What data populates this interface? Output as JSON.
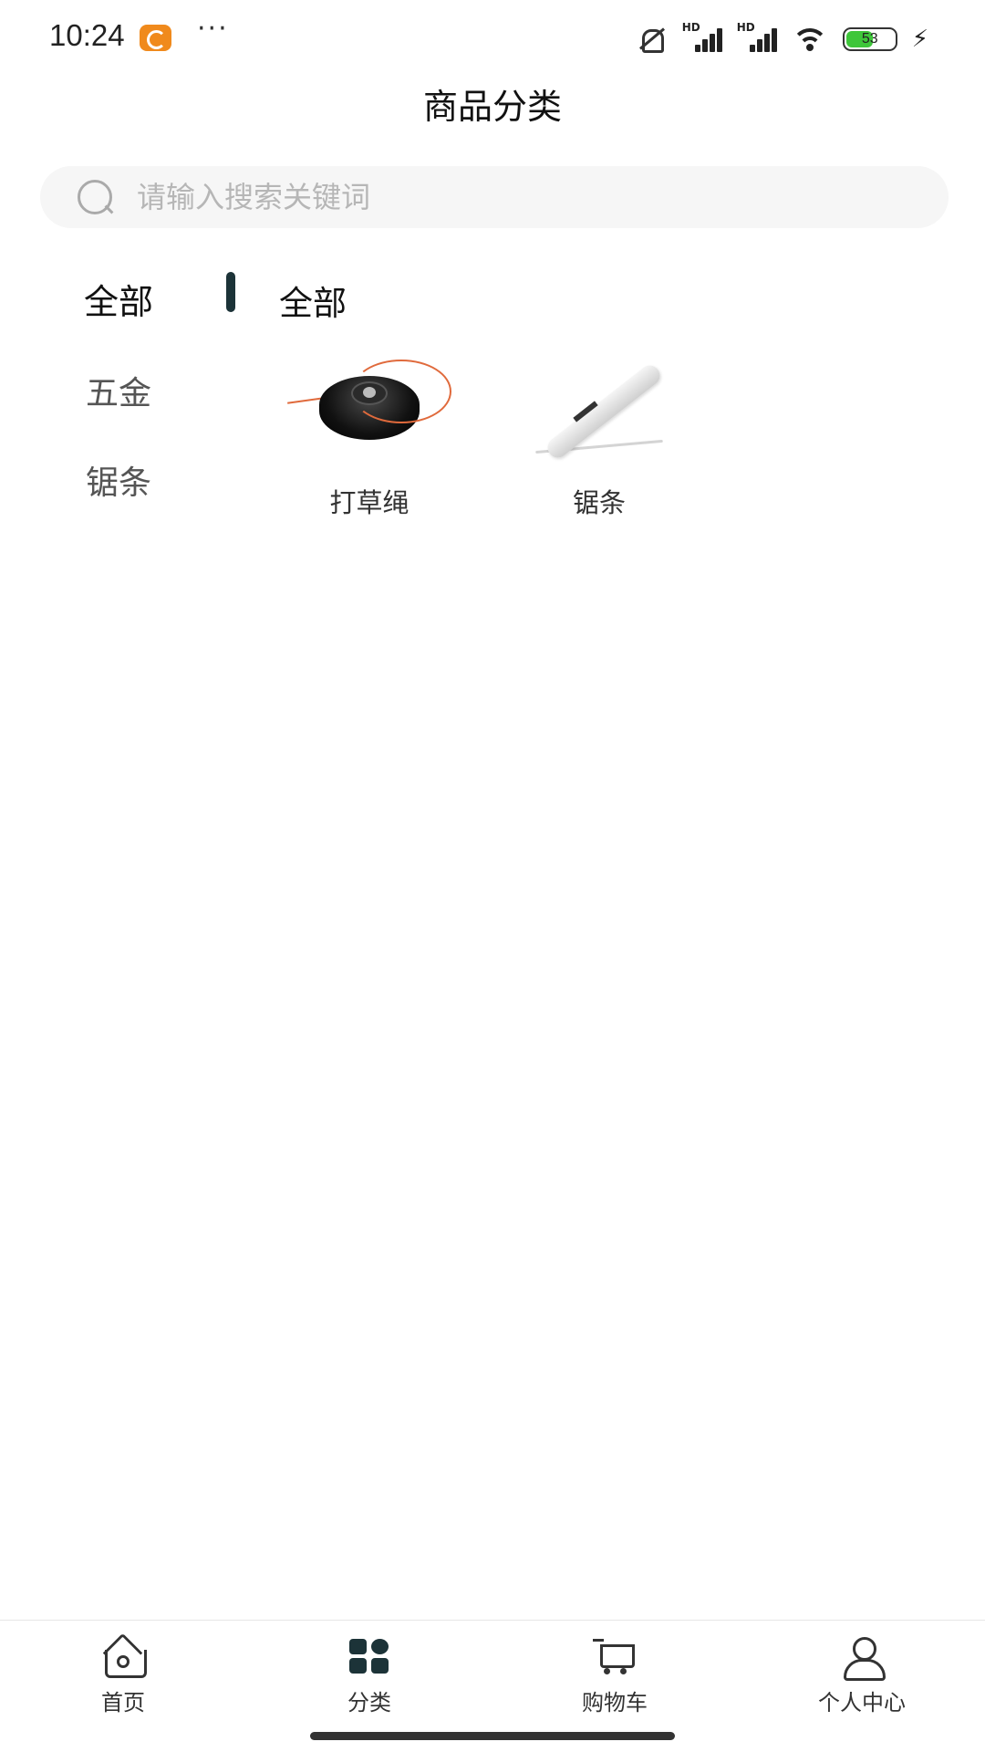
{
  "status_bar": {
    "time": "10:24",
    "more": "···",
    "hd_label": "HD",
    "battery_level": "53",
    "charge_glyph": "⚡"
  },
  "header": {
    "title": "商品分类"
  },
  "search": {
    "placeholder": "请输入搜索关键词",
    "value": ""
  },
  "sidebar": {
    "items": [
      {
        "label": "全部",
        "active": true
      },
      {
        "label": "五金",
        "active": false
      },
      {
        "label": "锯条",
        "active": false
      }
    ]
  },
  "content": {
    "section_title": "全部",
    "products": [
      {
        "name": "打草绳",
        "image": "trimmer-head-image"
      },
      {
        "name": "锯条",
        "image": "saw-bar-image"
      }
    ]
  },
  "tab_bar": {
    "tabs": [
      {
        "label": "首页",
        "icon": "home-icon"
      },
      {
        "label": "分类",
        "icon": "category-grid-icon",
        "active": true
      },
      {
        "label": "购物车",
        "icon": "cart-icon"
      },
      {
        "label": "个人中心",
        "icon": "user-icon"
      }
    ]
  },
  "colors": {
    "accent": "#1c3338",
    "charge_green": "#3ec63a",
    "app_badge": "#f08a1c"
  }
}
